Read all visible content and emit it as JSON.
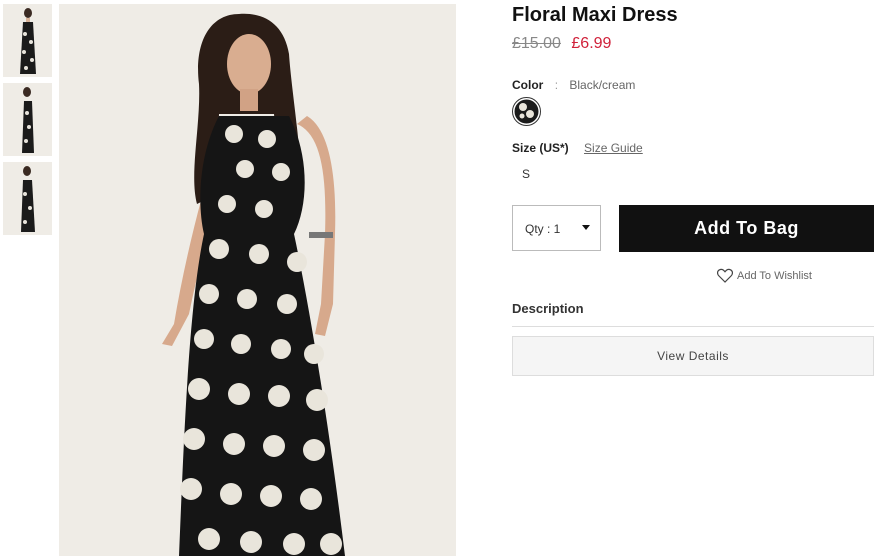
{
  "product": {
    "title": "Floral Maxi Dress",
    "old_price": "£15.00",
    "price": "£6.99",
    "color_label": "Color",
    "color_sep": ":",
    "color_value": "Black/cream",
    "size_label": "Size (US*)",
    "size_guide": "Size Guide",
    "size_option": "S",
    "qty_label": "Qty : 1",
    "add_to_bag": "Add To Bag",
    "wishlist": "Add To Wishlist",
    "description_title": "Description",
    "view_details": "View Details"
  },
  "colors": {
    "price_sale": "#d0213a",
    "button_bg": "#111111",
    "image_bg": "#efece6"
  },
  "icons": {
    "wishlist": "heart-outline-icon",
    "qty_dropdown": "caret-down-icon"
  }
}
